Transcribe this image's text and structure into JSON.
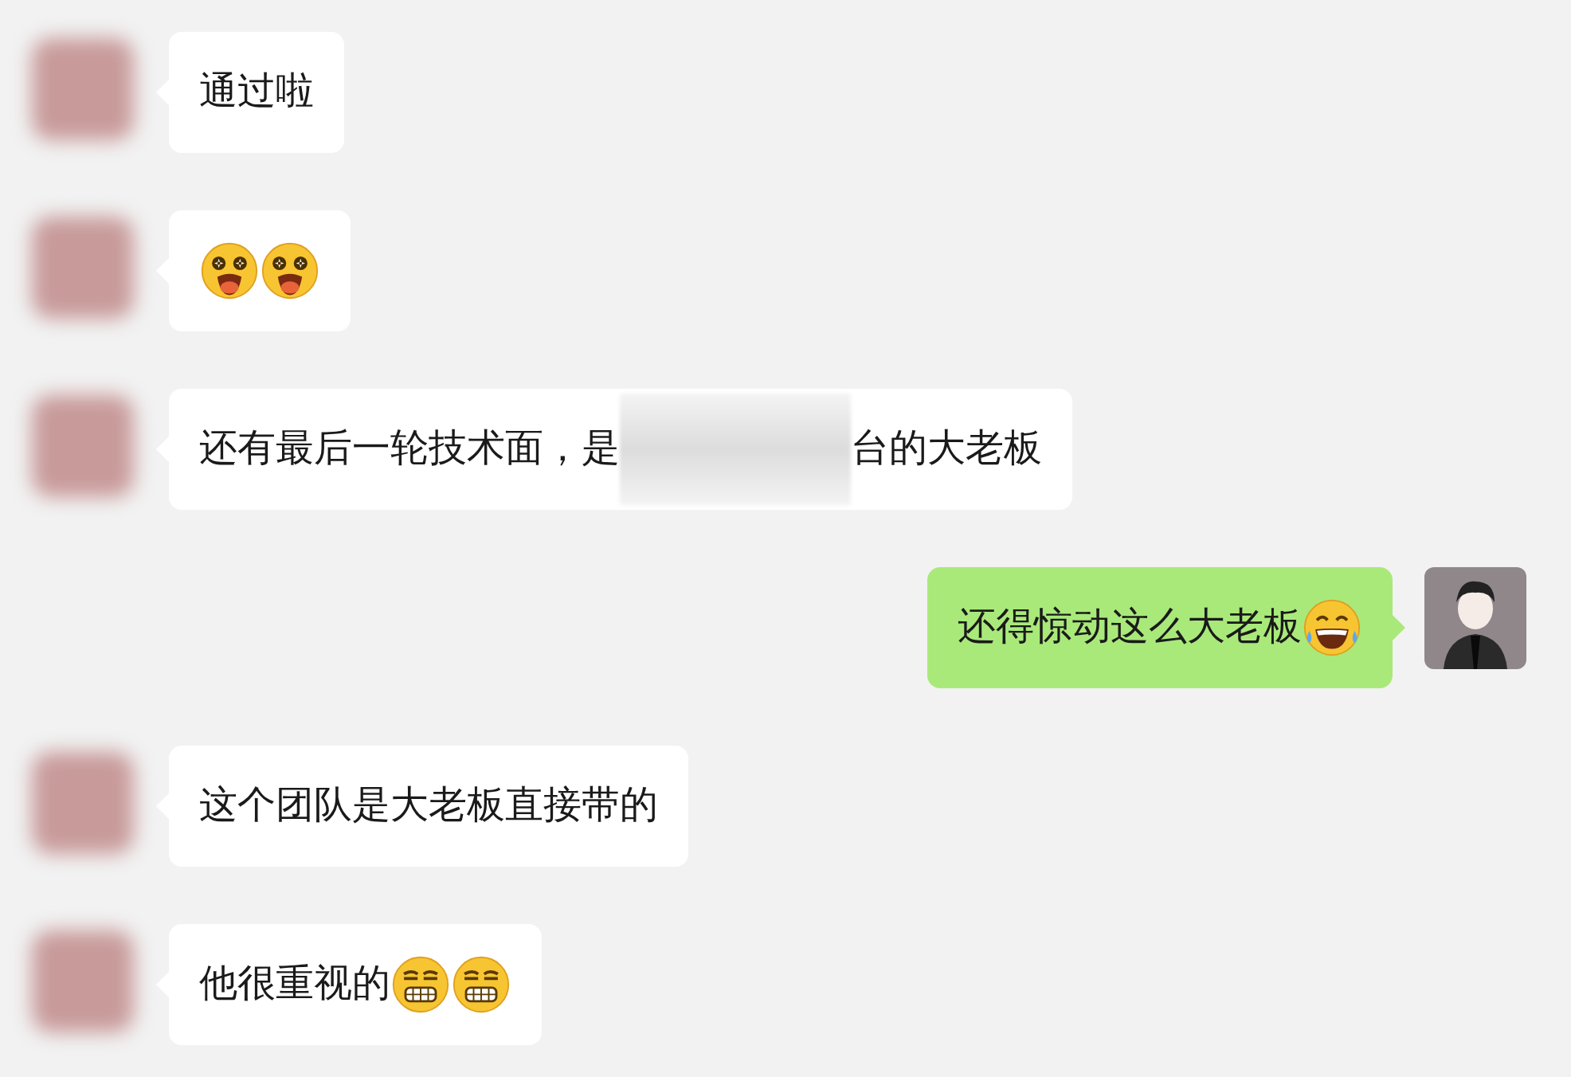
{
  "messages": [
    {
      "kind": "received",
      "parts": [
        {
          "kind": "text",
          "text": "通过啦"
        }
      ]
    },
    {
      "kind": "received",
      "parts": [
        {
          "kind": "wow"
        },
        {
          "kind": "wow"
        }
      ]
    },
    {
      "kind": "received",
      "parts": [
        {
          "kind": "text",
          "text": "还有最后一轮技术面，是"
        },
        {
          "kind": "blur"
        },
        {
          "kind": "text",
          "text": "台的大老板"
        }
      ]
    },
    {
      "kind": "sent",
      "parts": [
        {
          "kind": "text",
          "text": "还得惊动这么大老板"
        },
        {
          "kind": "laugh"
        }
      ]
    },
    {
      "kind": "received",
      "parts": [
        {
          "kind": "text",
          "text": "这个团队是大老板直接带的"
        }
      ]
    },
    {
      "kind": "received",
      "parts": [
        {
          "kind": "text",
          "text": "他很重视的"
        },
        {
          "kind": "grin"
        },
        {
          "kind": "grin"
        }
      ]
    }
  ]
}
